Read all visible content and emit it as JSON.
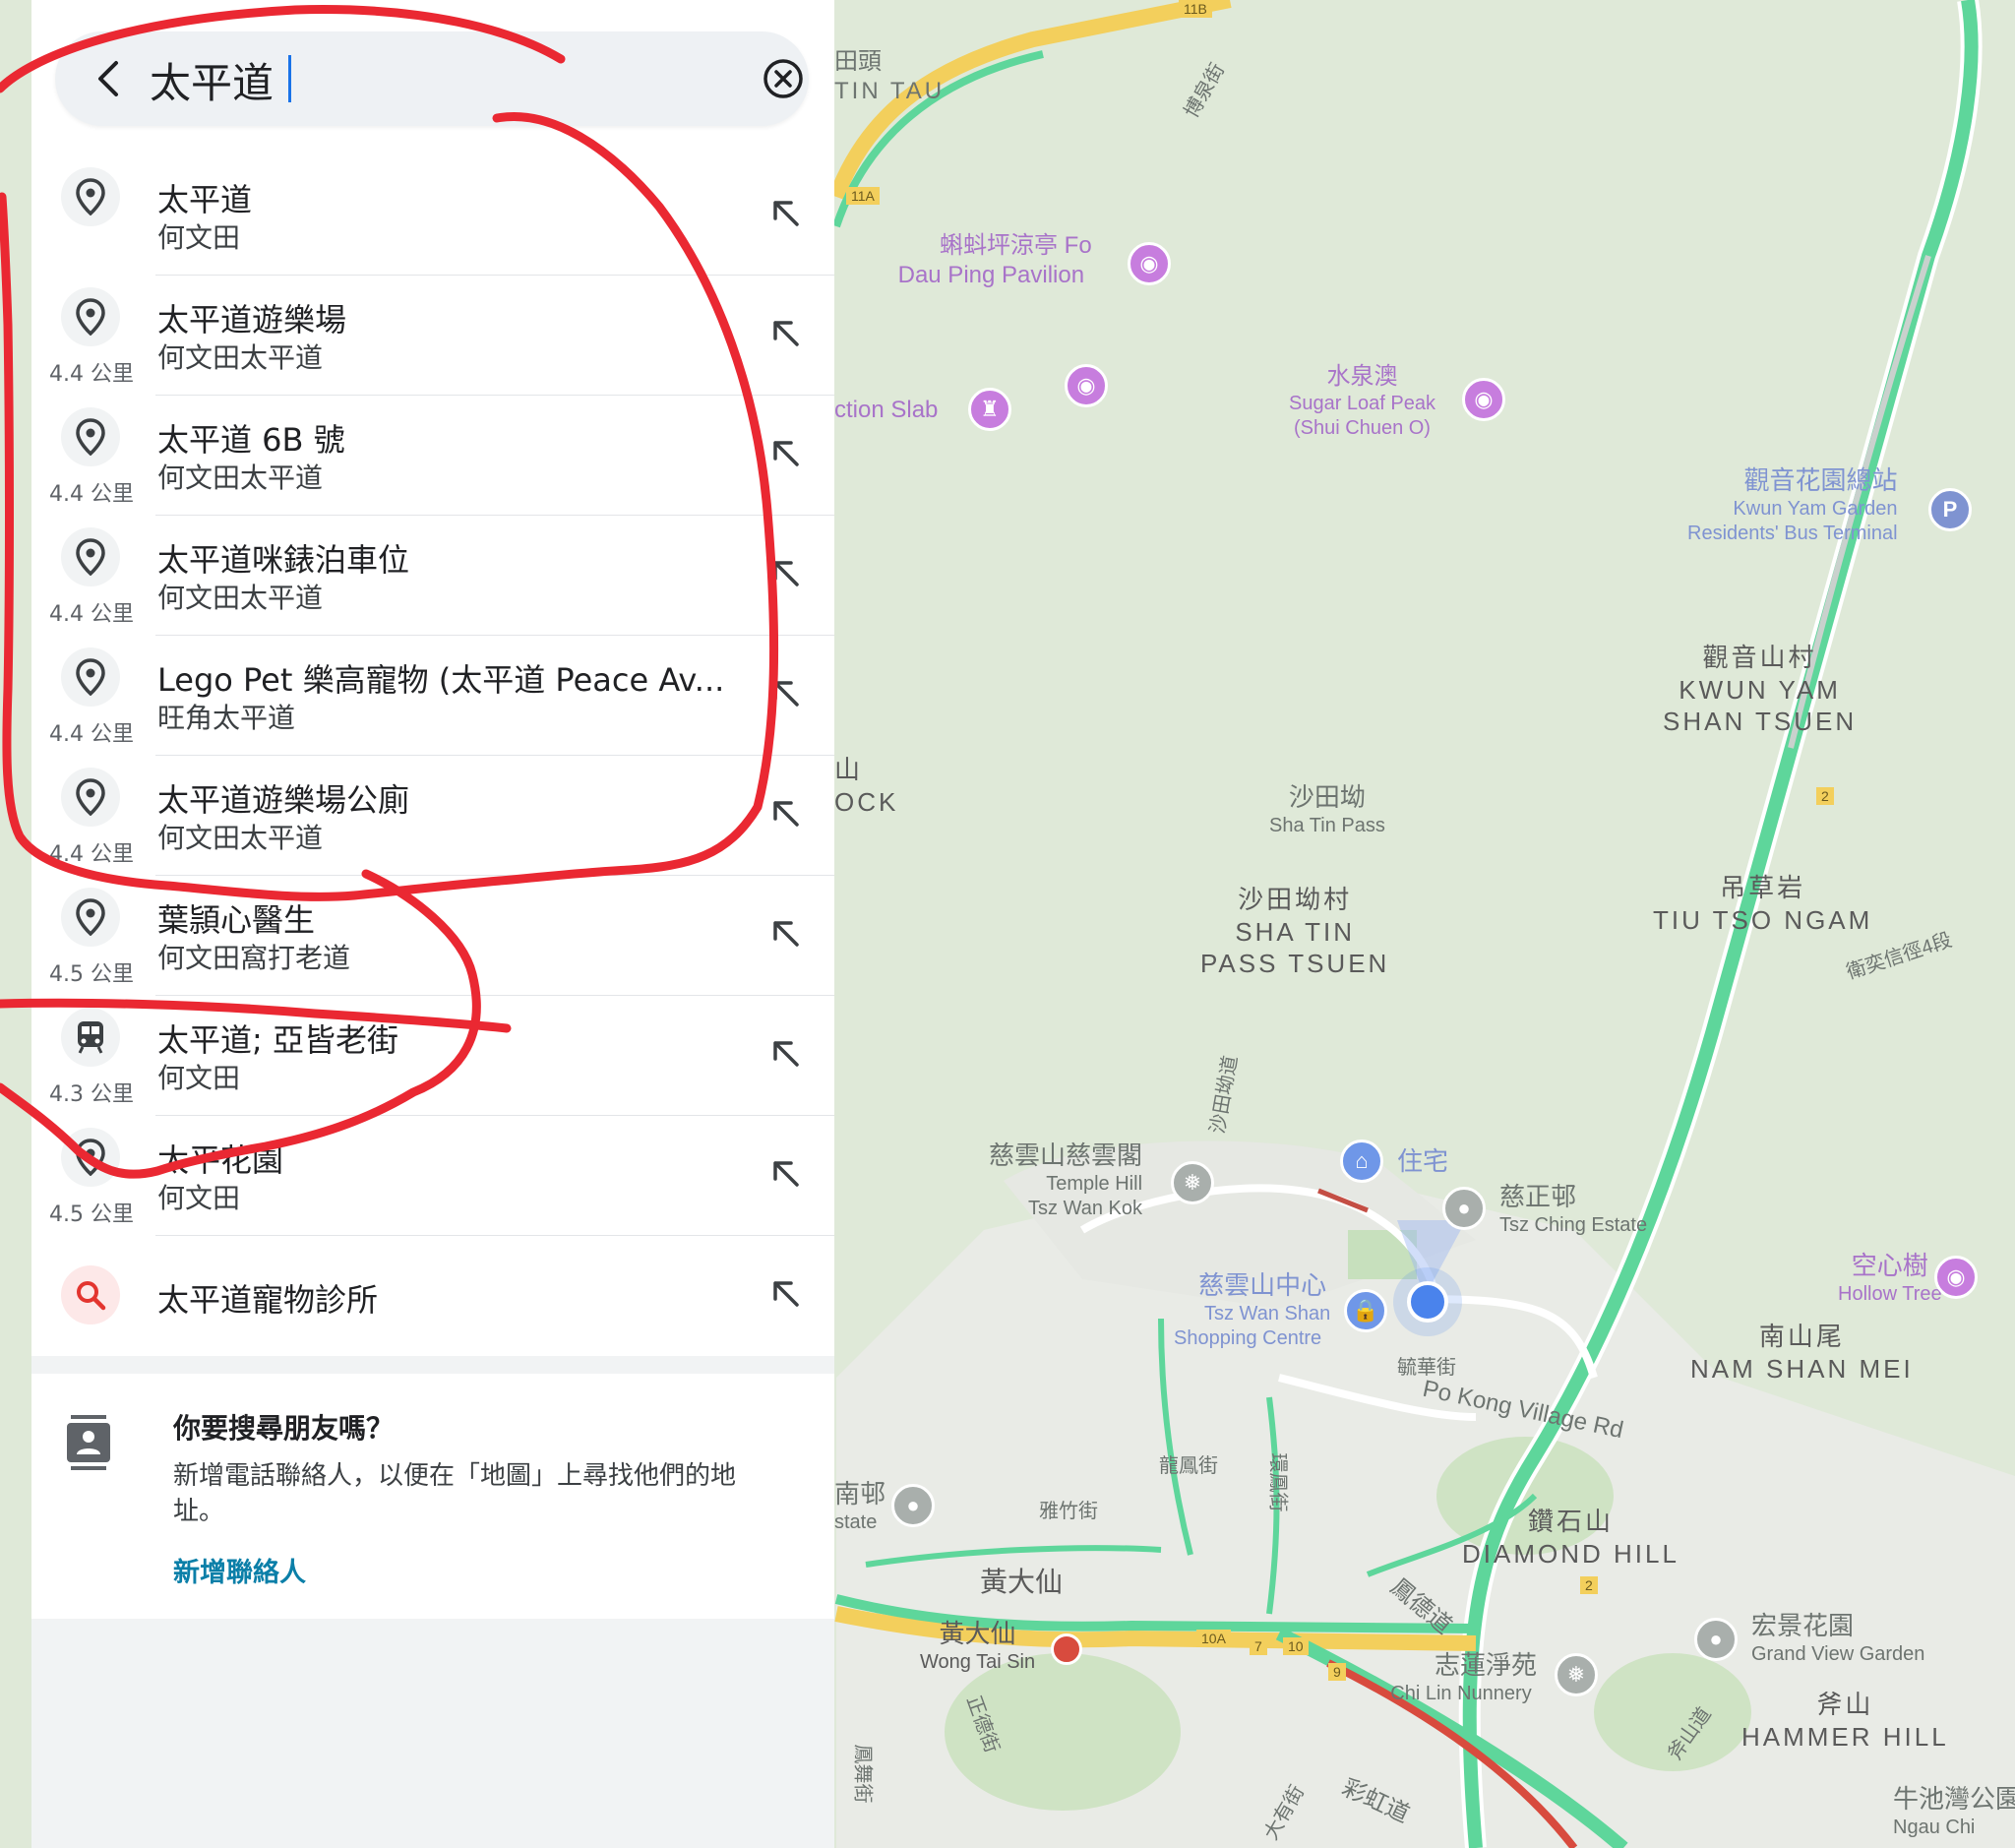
{
  "search": {
    "query": "太平道",
    "back_icon": "chevron-left-icon",
    "clear_icon": "close-circle-icon"
  },
  "results": [
    {
      "title": "太平道",
      "subtitle": "何文田",
      "distance": "",
      "icon": "location-pin-icon"
    },
    {
      "title": "太平道遊樂場",
      "subtitle": "何文田太平道",
      "distance": "4.4 公里",
      "icon": "location-pin-icon"
    },
    {
      "title": "太平道 6B 號",
      "subtitle": "何文田太平道",
      "distance": "4.4 公里",
      "icon": "location-pin-icon"
    },
    {
      "title": "太平道咪錶泊車位",
      "subtitle": "何文田太平道",
      "distance": "4.4 公里",
      "icon": "location-pin-icon"
    },
    {
      "title": "Lego Pet 樂高寵物 (太平道 Peace Av...",
      "subtitle": "旺角太平道",
      "distance": "4.4 公里",
      "icon": "location-pin-icon"
    },
    {
      "title": "太平道遊樂場公廁",
      "subtitle": "何文田太平道",
      "distance": "4.4 公里",
      "icon": "location-pin-icon"
    },
    {
      "title": "葉頴心醫生",
      "subtitle": "何文田窩打老道",
      "distance": "4.5 公里",
      "icon": "location-pin-icon"
    },
    {
      "title": "太平道; 亞皆老街",
      "subtitle": "何文田",
      "distance": "4.3 公里",
      "icon": "bus-icon"
    },
    {
      "title": "太平花園",
      "subtitle": "何文田",
      "distance": "4.5 公里",
      "icon": "location-pin-icon"
    },
    {
      "title": "太平道寵物診所",
      "subtitle": "",
      "distance": "",
      "icon": "search-icon"
    }
  ],
  "friends_card": {
    "title": "你要搜尋朋友嗎？",
    "body": "新增電話聯絡人，以便在「地圖」上尋找他們的地址。",
    "action": "新增聯絡人",
    "icon": "contact-card-icon"
  },
  "map": {
    "labels": {
      "tin_tau_zh": "田頭",
      "tin_tau_en": "TIN TAU",
      "pok_street": "博泉街",
      "fo_dau_zh": "蝌蚪坪涼亭 Fo",
      "fo_dau_en": "Dau Ping Pavilion",
      "action_slab": "ction Slab",
      "shui_chuen_zh": "水泉澳",
      "shui_chuen_en1": "Sugar Loaf Peak",
      "shui_chuen_en2": "(Shui Chuen O)",
      "kwun_yam_bus_zh": "觀音花園總站",
      "kwun_yam_bus_en1": "Kwun Yam Garden",
      "kwun_yam_bus_en2": "Residents' Bus Terminal",
      "kwun_yam_village_zh": "觀音山村",
      "kwun_yam_village_en1": "KWUN YAM",
      "kwun_yam_village_en2": "SHAN TSUEN",
      "rock_zh": "山",
      "rock_en": "OCK",
      "sha_tin_pass_zh": "沙田坳",
      "sha_tin_pass_en": "Sha Tin Pass",
      "sha_tin_village_zh": "沙田坳村",
      "sha_tin_village_en1": "SHA TIN",
      "sha_tin_village_en2": "PASS TSUEN",
      "tiu_tso_zh": "吊草岩",
      "tiu_tso_en": "TIU TSO NGAM",
      "wilson_trail": "衛奕信徑4段",
      "sha_tin_pass_rd": "沙田坳道",
      "temple_hill_zh": "慈雲山慈雲閣",
      "temple_hill_en1": "Temple Hill",
      "temple_hill_en2": "Tsz Wan Kok",
      "residence": "住宅",
      "tsz_ching_zh": "慈正邨",
      "tsz_ching_en": "Tsz Ching Estate",
      "hollow_tree_zh": "空心樹",
      "hollow_tree_en": "Hollow Tree",
      "nam_shan_zh": "南山尾",
      "nam_shan_en": "NAM SHAN MEI",
      "tsz_wan_centre_zh": "慈雲山中心",
      "tsz_wan_centre_en1": "Tsz Wan Shan",
      "tsz_wan_centre_en2": "Shopping Centre",
      "yuk_wah_st": "毓華街",
      "po_kong_rd": "Po Kong Village Rd",
      "lung_fung_st": "龍鳳街",
      "wan_fung_st": "環鳳街",
      "estate_zh": "南邨",
      "estate_en": "state",
      "nga_chuk_st": "雅竹街",
      "diamond_hill_zh": "鑽石山",
      "diamond_hill_en": "DIAMOND HILL",
      "wong_tai_sin_area": "黃大仙",
      "wong_tai_sin_stn_zh": "黃大仙",
      "wong_tai_sin_stn_en": "Wong Tai Sin",
      "fung_tak_rd": "鳳德道",
      "chi_lin_zh": "志蓮淨苑",
      "chi_lin_en": "Chi Lin Nunnery",
      "grand_view_zh": "宏景花園",
      "grand_view_en": "Grand View Garden",
      "hammer_hill_zh": "斧山",
      "hammer_hill_en": "HAMMER HILL",
      "fu_shan_rd": "斧山道",
      "ngau_chi_zh": "牛池灣公園",
      "ngau_chi_en": "Ngau Chi",
      "ching_tak_st": "正德街",
      "fung_mo_st": "鳳舞街",
      "choi_hung_rd": "彩虹道",
      "tai_yau_st": "大有街",
      "route_11b": "11B",
      "route_11a": "11A",
      "route_10a": "10A",
      "route_7": "7",
      "route_10": "10",
      "route_9": "9",
      "route_2a": "2",
      "route_2b": "2",
      "parking": "P"
    }
  }
}
